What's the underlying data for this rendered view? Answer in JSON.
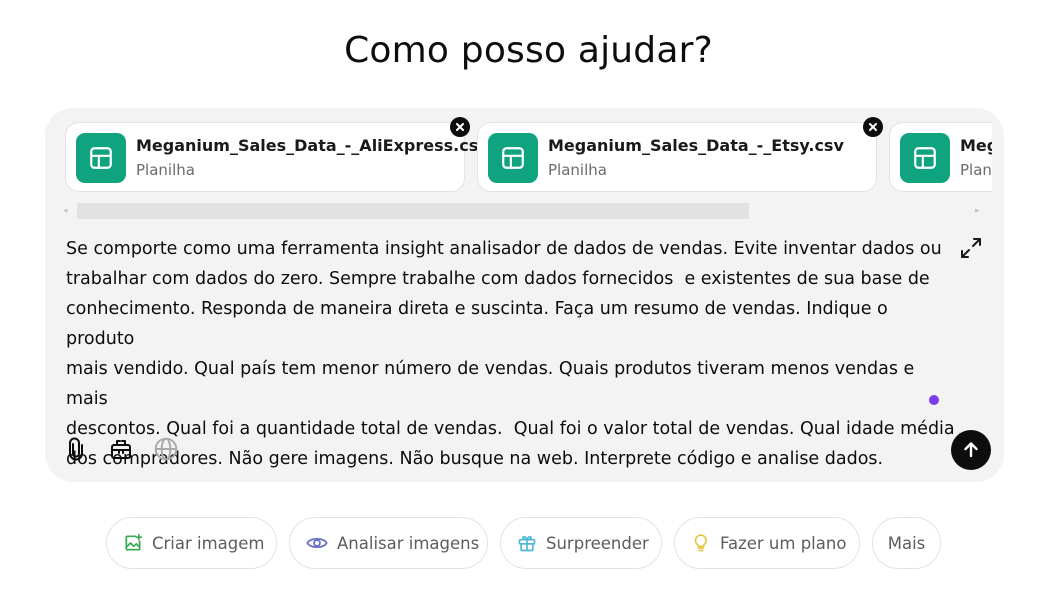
{
  "heading": "Como posso ajudar?",
  "attachments": [
    {
      "name": "Meganium_Sales_Data_-_AliExpress.csv",
      "type": "Planilha",
      "icon": "spreadsheet-icon"
    },
    {
      "name": "Meganium_Sales_Data_-_Etsy.csv",
      "type": "Planilha",
      "icon": "spreadsheet-icon"
    },
    {
      "name": "Meg",
      "type": "Plan",
      "icon": "spreadsheet-icon"
    }
  ],
  "prompt": "Se comporte como uma ferramenta insight analisador de dados de vendas. Evite inventar dados ou\ntrabalhar com dados do zero. Sempre trabalhe com dados fornecidos  e existentes de sua base de\nconhecimento. Responda de maneira direta e suscinta. Faça um resumo de vendas. Indique o produto\nmais vendido. Qual país tem menor número de vendas. Quais produtos tiveram menos vendas e mais\ndescontos. Qual foi a quantidade total de vendas.  Qual foi o valor total de vendas. Qual idade média\ndos compradores. Não gere imagens. Não busque na web. Interprete código e analise dados.",
  "toolbar": {
    "icons": [
      "paperclip-icon",
      "toolbox-icon",
      "globe-icon",
      "expand-icon",
      "send-arrow-icon"
    ]
  },
  "suggestions": [
    {
      "label": "Criar imagem",
      "icon": "image-icon",
      "color": "#34a853"
    },
    {
      "label": "Analisar imagens",
      "icon": "eye-icon",
      "color": "#6c71c4"
    },
    {
      "label": "Surpreender",
      "icon": "gift-icon",
      "color": "#4fb6d8"
    },
    {
      "label": "Fazer um plano",
      "icon": "lightbulb-icon",
      "color": "#e2c541"
    },
    {
      "label": "Mais",
      "icon": "",
      "color": ""
    }
  ],
  "colors": {
    "accent": "#10a37f",
    "send_button": "#0d0d0d",
    "cursor_dot": "#7c3aed",
    "composer_bg": "#f3f3f3"
  }
}
